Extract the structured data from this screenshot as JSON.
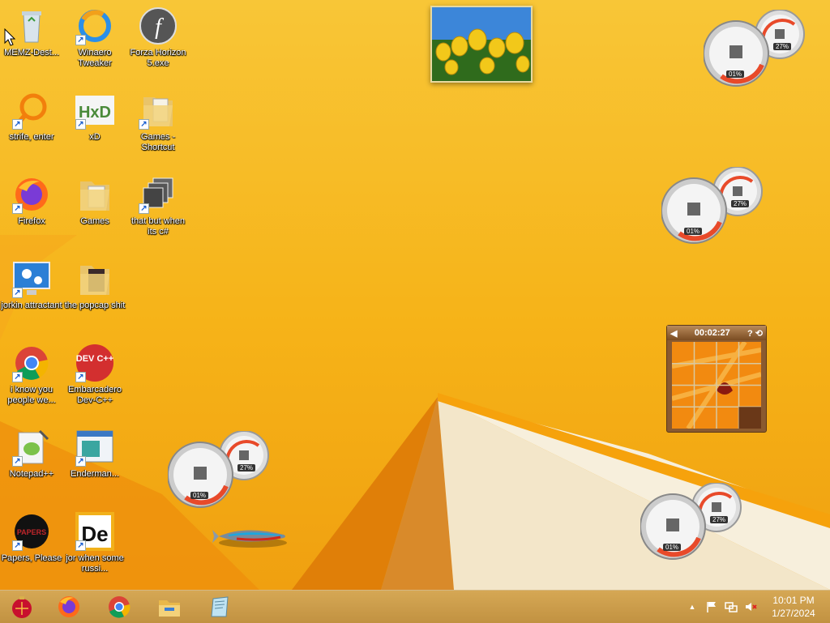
{
  "desktop_icons": [
    {
      "label": "MEMZ-Destructive.exe",
      "display": "MEMZ-Dest..."
    },
    {
      "label": "Winaero Tweaker"
    },
    {
      "label": "Forza Horizon 5.exe"
    },
    {
      "label": "strife, enter"
    },
    {
      "label": "xD"
    },
    {
      "label": "Games - Shortcut"
    },
    {
      "label": "Firefox"
    },
    {
      "label": "Games"
    },
    {
      "label": "that but when its c#"
    },
    {
      "label": "jorkin attractant"
    },
    {
      "label": "the popcap shit"
    },
    {
      "label": "i know you people we..."
    },
    {
      "label": "Embarcadero Dev-C++"
    },
    {
      "label": "Notepad++"
    },
    {
      "label": "Enderman..."
    },
    {
      "label": "Papers, Please"
    },
    {
      "label": "jor when some russi..."
    }
  ],
  "icon_glyphs": {
    "dev": "DEV C++",
    "hxd": "HxD",
    "flash": "f",
    "de": "De",
    "papers": "PAPERS"
  },
  "gauges": {
    "cpu": "01%",
    "memory": "27%"
  },
  "puzzle": {
    "time": "00:02:27",
    "help": "?",
    "settings": "⟲",
    "back": "◀"
  },
  "tray": {
    "clock_time": "10:01 PM",
    "clock_date": "1/27/2024",
    "chevron": "▲"
  },
  "colors": {
    "accent": "#f6b318",
    "taskbar": "#c79240",
    "wall_white": "#f3e6c9"
  }
}
